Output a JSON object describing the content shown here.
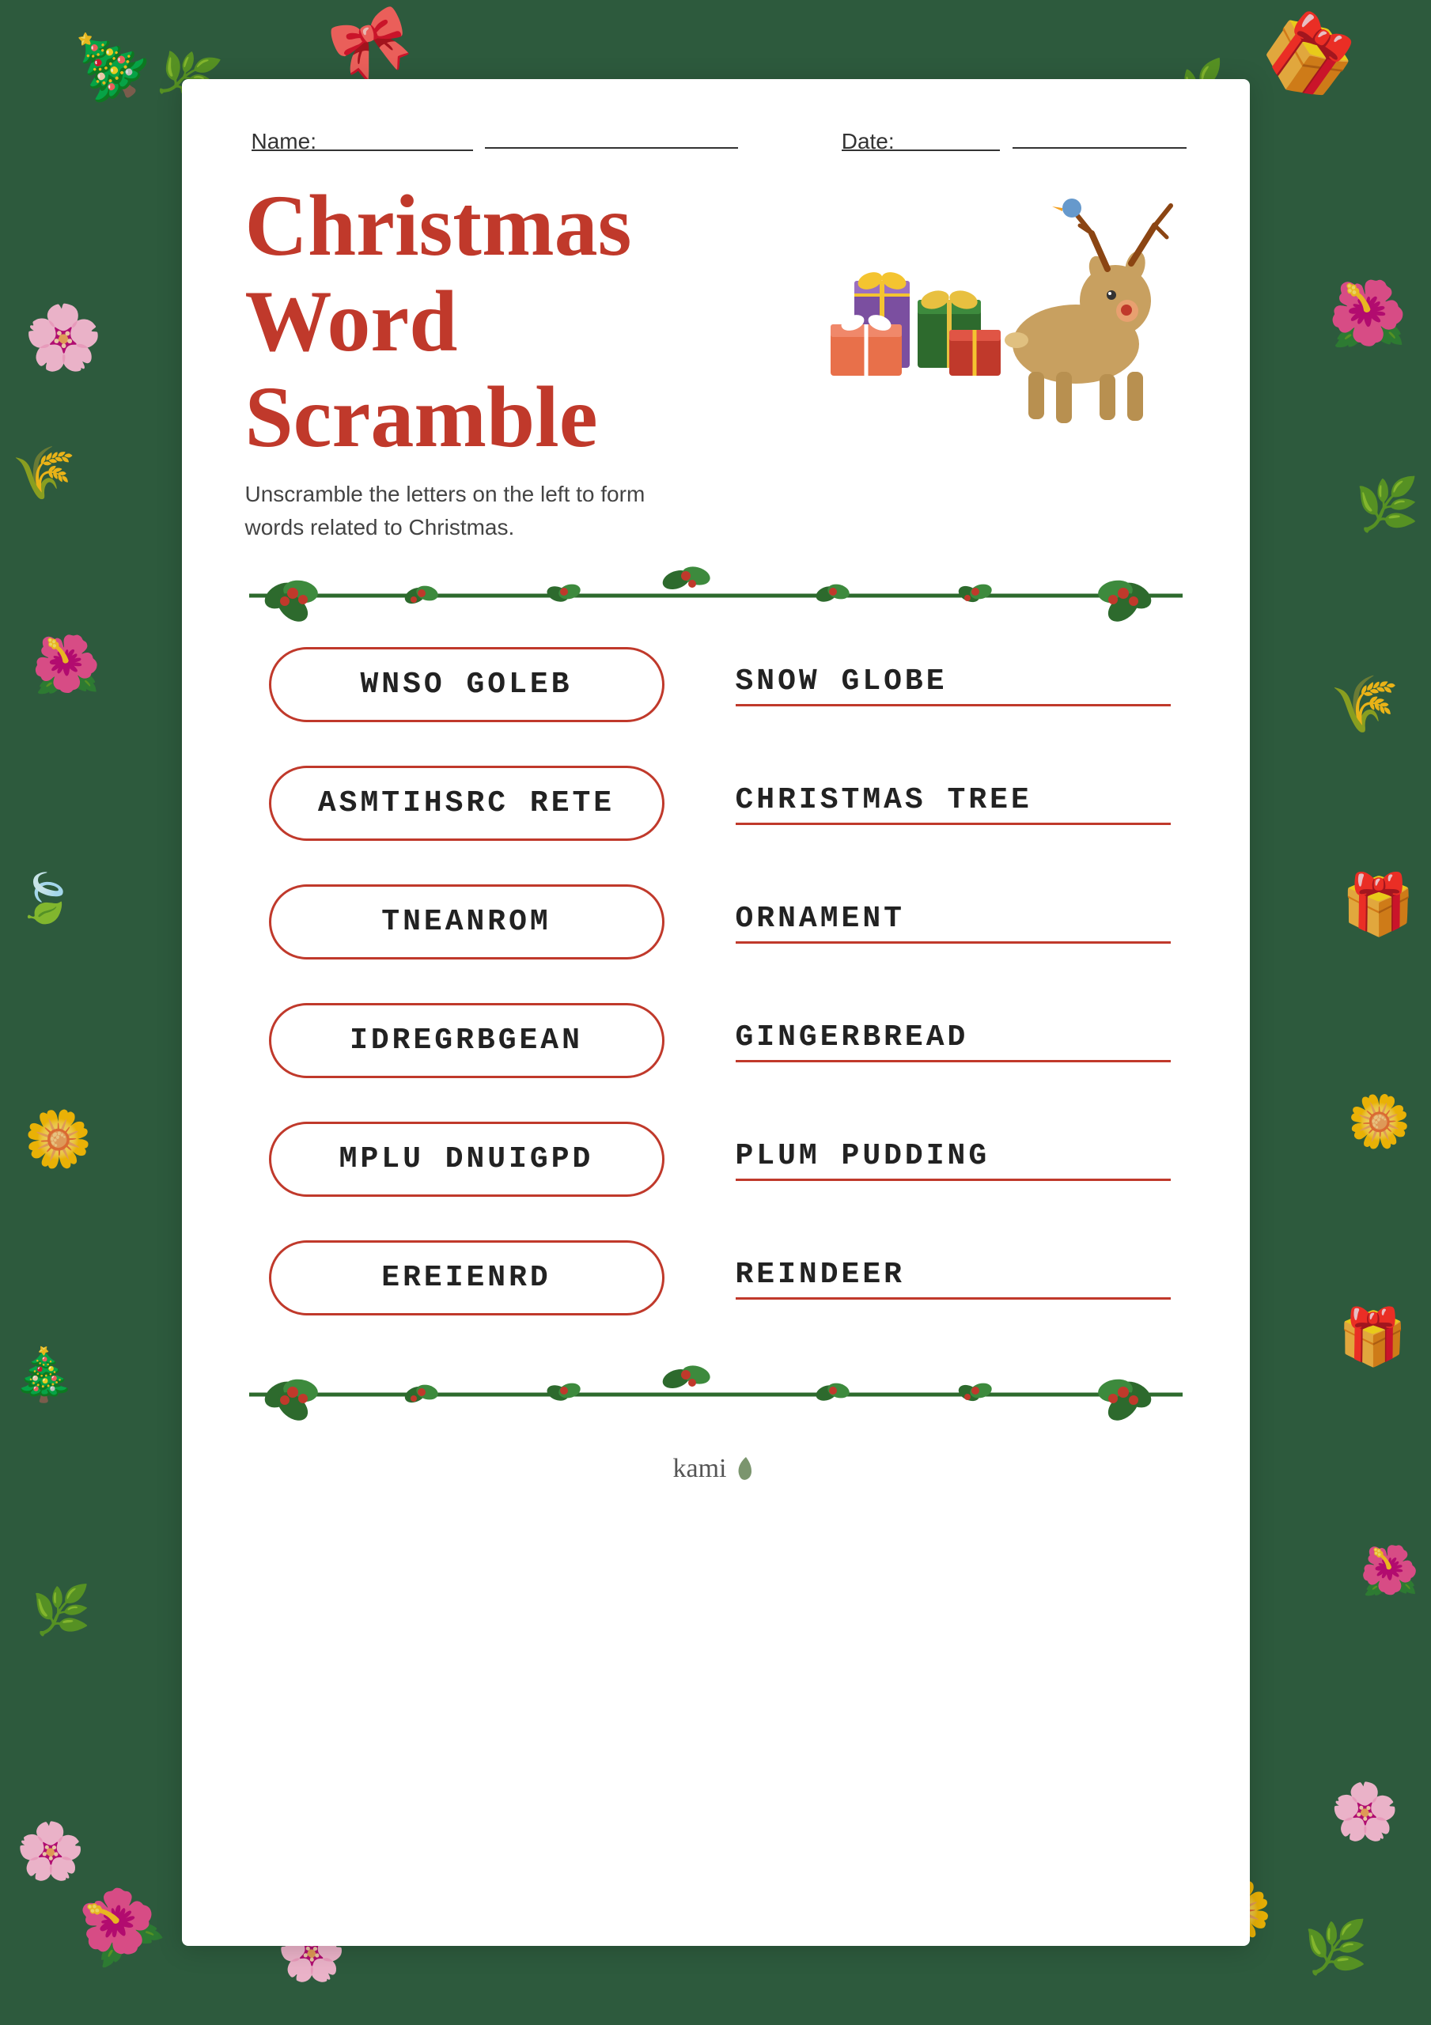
{
  "page": {
    "background_color": "#2d5a3d",
    "title": "Christmas Word Scramble"
  },
  "header": {
    "name_label": "Name:",
    "name_placeholder": "________________________",
    "date_label": "Date:",
    "date_placeholder": "______________"
  },
  "main_title": {
    "line1": "Christmas Word",
    "line2": "Scramble",
    "subtitle": "Unscramble the letters on the left to form words related to Christmas."
  },
  "scramble_items": [
    {
      "scrambled": "WNSO GOLEB",
      "answer": "SNOW GLOBE"
    },
    {
      "scrambled": "ASMTIHSRC RETE",
      "answer": "CHRISTMAS TREE"
    },
    {
      "scrambled": "TNEANROM",
      "answer": "ORNAMENT"
    },
    {
      "scrambled": "IDREGRBGEAN",
      "answer": "GINGERBREAD"
    },
    {
      "scrambled": "MPLU DNUIGPD",
      "answer": "PLUM PUDDING"
    },
    {
      "scrambled": "EREIENRD",
      "answer": "REINDEER"
    }
  ],
  "footer": {
    "brand": "kami"
  }
}
